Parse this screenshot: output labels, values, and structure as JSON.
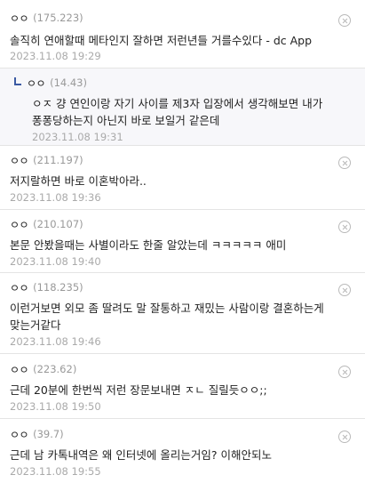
{
  "comments": [
    {
      "nick": "ㅇㅇ",
      "ip": "(175.223)",
      "text": "솔직히 연애할때 메타인지 잘하면 저런년들 거를수있다 - dc App",
      "date": "2023.11.08 19:29"
    },
    {
      "reply": true,
      "nick": "ㅇㅇ",
      "ip": "(14.43)",
      "text": "ㅇㅈ 걍 연인이랑 자기 사이를 제3자 입장에서 생각해보면 내가 퐁퐁당하는지 아닌지 바로 보일거 같은데",
      "date": "2023.11.08 19:31"
    },
    {
      "nick": "ㅇㅇ",
      "ip": "(211.197)",
      "text": "저지랄하면 바로 이혼박아라..",
      "date": "2023.11.08 19:36"
    },
    {
      "nick": "ㅇㅇ",
      "ip": "(210.107)",
      "text": "본문 안봤을때는 사별이라도 한줄 알았는데 ㅋㅋㅋㅋㅋ 애미",
      "date": "2023.11.08 19:40"
    },
    {
      "nick": "ㅇㅇ",
      "ip": "(118.235)",
      "text": "이런거보면 외모 좀 딸려도 말 잘통하고 재밌는 사람이랑 결혼하는게 맞는거같다",
      "date": "2023.11.08 19:46"
    },
    {
      "nick": "ㅇㅇ",
      "ip": "(223.62)",
      "text": "근데 20분에 한번씩 저런 장문보내면 ㅈㄴ 질릴듯ㅇㅇ;;",
      "date": "2023.11.08 19:50"
    },
    {
      "nick": "ㅇㅇ",
      "ip": "(39.7)",
      "text": "근데 남 카톡내역은 왜 인터넷에 올리는거임? 이해안되노",
      "date": "2023.11.08 19:55"
    }
  ],
  "colors": {
    "reply_marker": "#3b5aa3",
    "date": "#aaaaaa",
    "ip": "#999999",
    "divider": "#e4e4e4",
    "reply_bg": "#f7f7fa"
  },
  "icons": {
    "delete": "close-circle-icon",
    "reply": "reply-arrow-icon"
  }
}
